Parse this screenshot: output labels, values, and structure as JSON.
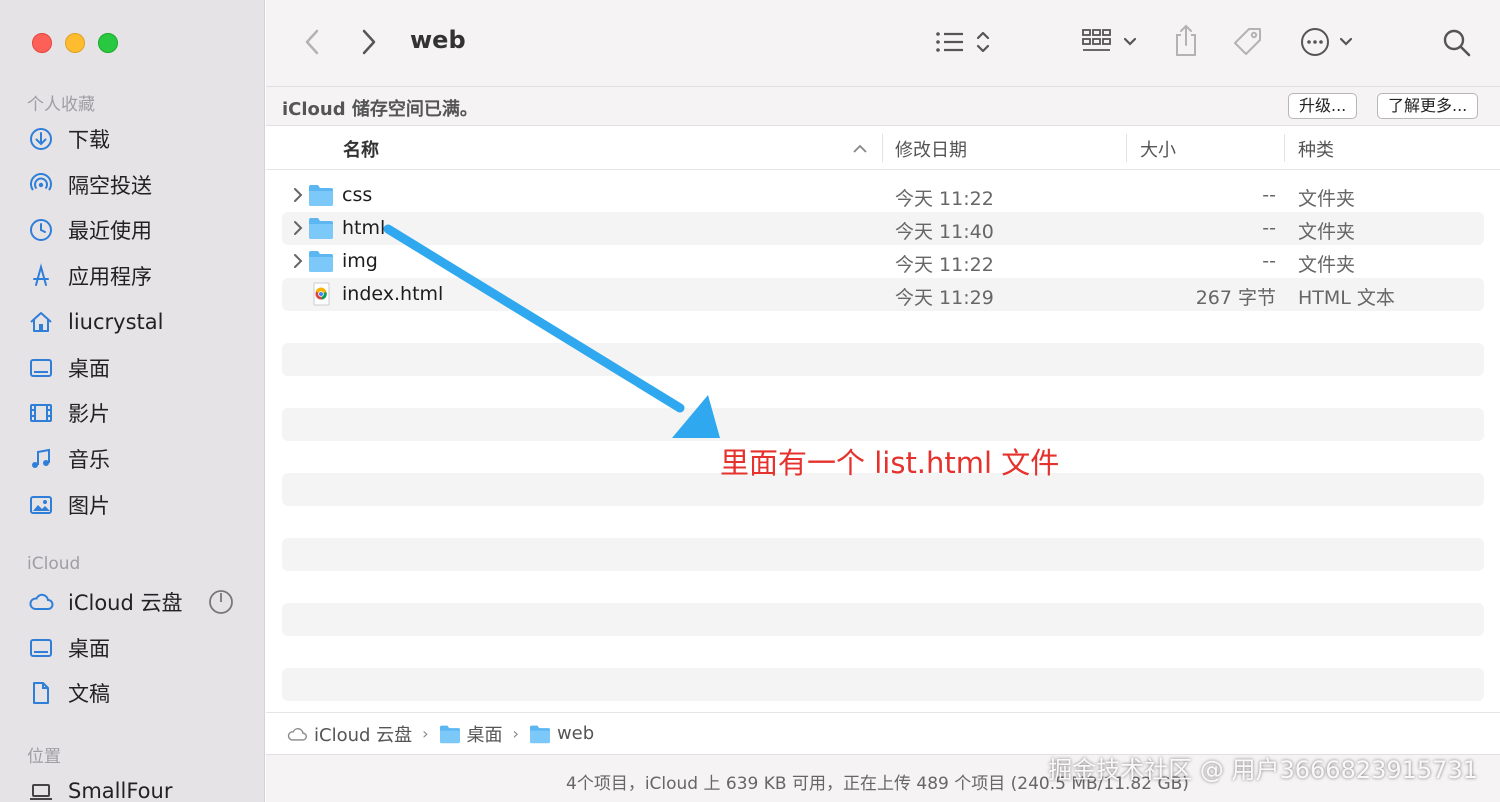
{
  "window": {
    "title": "web"
  },
  "sidebar": {
    "favorites_title": "个人收藏",
    "favorites": [
      {
        "label": "下载",
        "icon": "download-icon"
      },
      {
        "label": "隔空投送",
        "icon": "airdrop-icon"
      },
      {
        "label": "最近使用",
        "icon": "clock-icon"
      },
      {
        "label": "应用程序",
        "icon": "applications-icon"
      },
      {
        "label": "liucrystal",
        "icon": "home-icon"
      },
      {
        "label": "桌面",
        "icon": "desktop-icon"
      },
      {
        "label": "影片",
        "icon": "film-icon"
      },
      {
        "label": "音乐",
        "icon": "music-icon"
      },
      {
        "label": "图片",
        "icon": "photo-icon"
      }
    ],
    "icloud_title": "iCloud",
    "icloud": [
      {
        "label": "iCloud 云盘",
        "icon": "cloud-icon"
      },
      {
        "label": "桌面",
        "icon": "desktop-icon"
      },
      {
        "label": "文稿",
        "icon": "document-icon"
      }
    ],
    "locations_title": "位置",
    "locations": [
      {
        "label": "SmallFour",
        "icon": "laptop-icon"
      }
    ]
  },
  "banner": {
    "text": "iCloud 储存空间已满。",
    "upgrade_label": "升级...",
    "learn_more_label": "了解更多..."
  },
  "columns": {
    "name": "名称",
    "date": "修改日期",
    "size": "大小",
    "kind": "种类"
  },
  "files": [
    {
      "name": "css",
      "date": "今天 11:22",
      "size": "--",
      "kind": "文件夹",
      "type": "folder"
    },
    {
      "name": "html",
      "date": "今天 11:40",
      "size": "--",
      "kind": "文件夹",
      "type": "folder"
    },
    {
      "name": "img",
      "date": "今天 11:22",
      "size": "--",
      "kind": "文件夹",
      "type": "folder"
    },
    {
      "name": "index.html",
      "date": "今天 11:29",
      "size": "267 字节",
      "kind": "HTML 文本",
      "type": "html-file"
    }
  ],
  "pathbar": {
    "items": [
      "iCloud 云盘",
      "桌面",
      "web"
    ]
  },
  "status": {
    "text": "4个项目，iCloud 上 639 KB 可用，正在上传 489 个项目 (240.5 MB/11.82 GB)"
  },
  "annotation": {
    "text": "里面有一个 list.html 文件",
    "color": "#e5322d",
    "arrow_color": "#2fa8ef"
  },
  "watermark": {
    "text": "掘金技术社区 @ 用户3666823915731"
  }
}
